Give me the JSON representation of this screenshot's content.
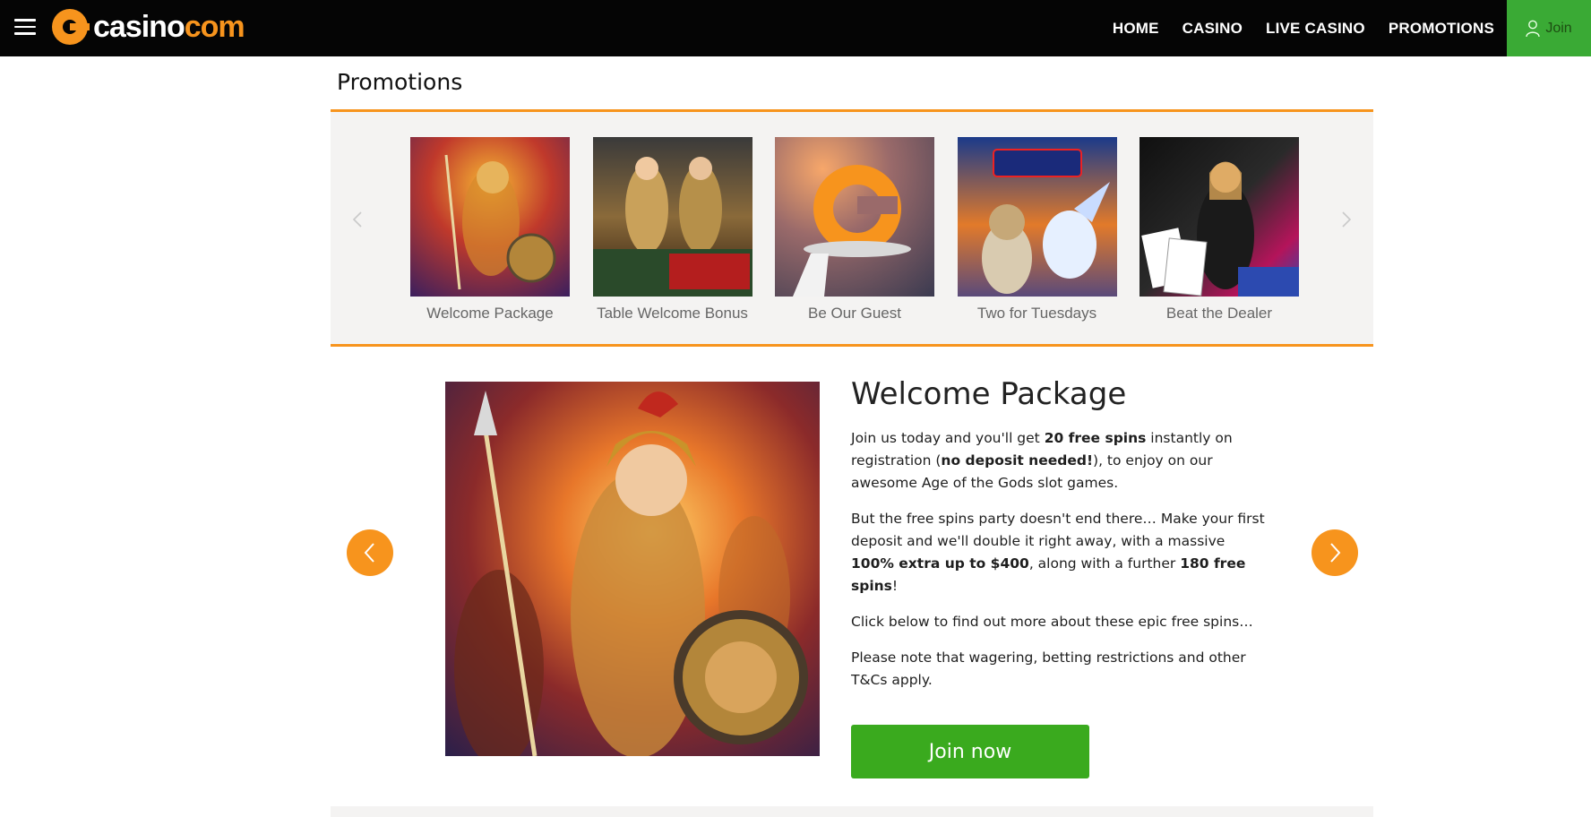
{
  "header": {
    "logo": {
      "part1": "casino",
      "part2": "com"
    },
    "nav": [
      {
        "label": "HOME"
      },
      {
        "label": "CASINO"
      },
      {
        "label": "LIVE CASINO"
      },
      {
        "label": "PROMOTIONS"
      }
    ],
    "join_label": "Join"
  },
  "page": {
    "title": "Promotions"
  },
  "promotions": {
    "tiles": [
      {
        "label": "Welcome Package",
        "icon": "warrior-goddess-image"
      },
      {
        "label": "Table Welcome Bonus",
        "icon": "live-dealers-roulette-image"
      },
      {
        "label": "Be Our Guest",
        "icon": "logo-on-tray-image"
      },
      {
        "label": "Two for Tuesdays",
        "icon": "lion-pegasus-image"
      },
      {
        "label": "Beat the Dealer",
        "icon": "dealer-cards-image"
      }
    ]
  },
  "feature": {
    "title": "Welcome Package",
    "p1": {
      "a": "Join us today and you'll get ",
      "b": "20 free spins",
      "c": " instantly on registration (",
      "d": "no deposit needed!",
      "e": "), to enjoy on our awesome Age of the Gods slot games."
    },
    "p2": {
      "a": "But the free spins party doesn't end there… Make your first deposit and we'll double it right away, with a massive ",
      "b": "100% extra up to $400",
      "c": ", along with a further ",
      "d": "180 free spins",
      "e": "!"
    },
    "p3": "Click below to find out more about these epic free spins…",
    "p4": "Please note that wagering, betting restrictions and other T&Cs apply.",
    "cta": "Join now"
  },
  "colors": {
    "accent": "#f7941d",
    "join": "#3aaa35",
    "cta": "#3aaa1e",
    "header_bg": "#050505",
    "strip_bg": "#f4f3f2"
  }
}
